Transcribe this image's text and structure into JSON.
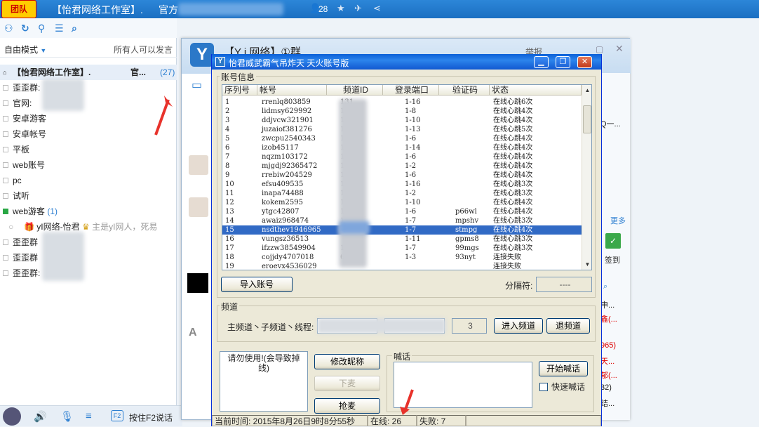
{
  "topbar": {
    "logo": "团队",
    "room_title": "【怡君网络工作室】.",
    "title_tail": "官方",
    "online_count": "28"
  },
  "left_panel": {
    "mode": "自由模式",
    "mode_hint": "所有人可以发言",
    "root": {
      "label": "【怡君网络工作室】.",
      "tail": "官...",
      "count": "(27)"
    },
    "items": [
      "歪歪群:",
      "官网:",
      "安卓游客",
      "安卓帐号",
      "平板",
      "web账号",
      "pc",
      "试听"
    ],
    "guest_channel": {
      "label": "web游客",
      "count": "(1)"
    },
    "guest_user": {
      "name": "yI网络-怡君",
      "status": "主是yI网人，死易"
    },
    "bottom_items": [
      "歪歪群",
      "歪歪群",
      "歪歪群:"
    ]
  },
  "bottombar": {
    "f2_hint": "按住F2说话"
  },
  "room_window": {
    "group_title": "【Y i 网络】①群",
    "report": "举报",
    "side": {
      "more": "更多",
      "checkin": "签到",
      "q1": "Q一...",
      "r1": "申...",
      "r2": "鑫(...",
      "r3": "965)",
      "r4": "天...",
      "r5": "郁(...",
      "r6": "32)",
      "r7": "结..."
    }
  },
  "dialog": {
    "title": "怡君威武霸气吊炸天  天火账号版",
    "account_group": "账号信息",
    "columns": [
      "序列号",
      "帐号",
      "频道ID",
      "登录端口",
      "验证码",
      "状态"
    ],
    "accounts": [
      {
        "seq": "1",
        "acct": "rrenlq803859",
        "chan": "131",
        "port": "1-16",
        "code": "",
        "status": "在线心跳6次"
      },
      {
        "seq": "2",
        "acct": "lidmsy629992",
        "chan": "131",
        "port": "1-8",
        "code": "",
        "status": "在线心跳4次"
      },
      {
        "seq": "3",
        "acct": "ddjvcw321901",
        "chan": "13",
        "port": "1-10",
        "code": "",
        "status": "在线心跳4次"
      },
      {
        "seq": "4",
        "acct": "juzaiof381276",
        "chan": "13",
        "port": "1-13",
        "code": "",
        "status": "在线心跳5次"
      },
      {
        "seq": "5",
        "acct": "zwcpu2540343",
        "chan": "13",
        "port": "1-6",
        "code": "",
        "status": "在线心跳4次"
      },
      {
        "seq": "6",
        "acct": "izob45117",
        "chan": "1",
        "port": "1-14",
        "code": "",
        "status": "在线心跳4次"
      },
      {
        "seq": "7",
        "acct": "nqzm103172",
        "chan": "1",
        "port": "1-6",
        "code": "",
        "status": "在线心跳4次"
      },
      {
        "seq": "8",
        "acct": "mjgdj92365472",
        "chan": "1",
        "port": "1-2",
        "code": "",
        "status": "在线心跳4次"
      },
      {
        "seq": "9",
        "acct": "rrebiw204529",
        "chan": "1",
        "port": "1-6",
        "code": "",
        "status": "在线心跳4次"
      },
      {
        "seq": "10",
        "acct": "efsu409535",
        "chan": "1",
        "port": "1-16",
        "code": "",
        "status": "在线心跳3次"
      },
      {
        "seq": "11",
        "acct": "inapa74488",
        "chan": "1",
        "port": "1-2",
        "code": "",
        "status": "在线心跳3次"
      },
      {
        "seq": "12",
        "acct": "kokem2595",
        "chan": "1",
        "port": "1-10",
        "code": "",
        "status": "在线心跳4次"
      },
      {
        "seq": "13",
        "acct": "ytgc42807",
        "chan": "1",
        "port": "1-6",
        "code": "p66wl",
        "status": "在线心跳4次"
      },
      {
        "seq": "14",
        "acct": "awaiz968474",
        "chan": "1",
        "port": "1-7",
        "code": "mpshv",
        "status": "在线心跳3次"
      },
      {
        "seq": "15",
        "acct": "nsdthev1946965",
        "chan": "1",
        "port": "1-7",
        "code": "stmpg",
        "status": "在线心跳4次"
      },
      {
        "seq": "16",
        "acct": "vungsz36513",
        "chan": "",
        "port": "1-11",
        "code": "gpms8",
        "status": "在线心跳3次"
      },
      {
        "seq": "17",
        "acct": "ifzzw38549904",
        "chan": "1",
        "port": "1-7",
        "code": "99mgs",
        "status": "在线心跳3次"
      },
      {
        "seq": "18",
        "acct": "cojjdy4707018",
        "chan": "698",
        "port": "1-3",
        "code": "93nyt",
        "status": "连接失败"
      },
      {
        "seq": "19",
        "acct": "eroevx4536029",
        "chan": "",
        "port": "",
        "code": "",
        "status": "连接失败"
      }
    ],
    "selected_row": "15",
    "import_btn": "导入账号",
    "separator_label": "分隔符:",
    "separator_value": "----",
    "channel_group": "频道",
    "channel_label": "主频道丶子频道丶线程:",
    "thread_value": "3",
    "enter_btn": "进入频道",
    "exit_btn": "退频道",
    "warning": "请勿使用!(会导致掉线)",
    "rename_btn": "修改昵称",
    "down_btn": "下麦",
    "grab_btn": "抢麦",
    "shout_group": "喊话",
    "start_shout_btn": "开始喊话",
    "fast_shout": "快速喊话",
    "status": {
      "time": "当前时间: 2015年8月26日9时8分55秒",
      "online": "在线: 26",
      "fail": "失败: 7"
    }
  }
}
